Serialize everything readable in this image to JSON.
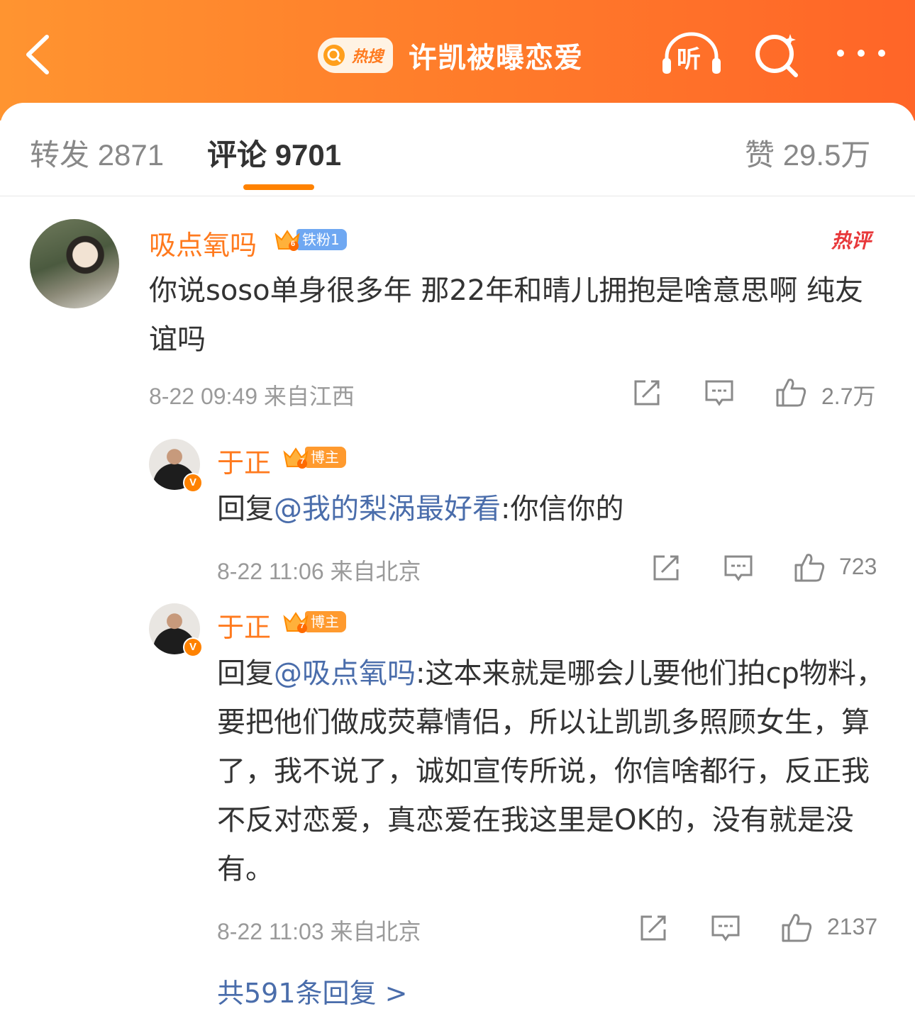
{
  "header": {
    "hot_badge": "热搜",
    "topic": "许凯被曝恋爱",
    "listen_label": "听",
    "colors": {
      "gradient_start": "#ff9430",
      "gradient_end": "#ff6528"
    }
  },
  "tabs": [
    {
      "label": "转发",
      "count": "2871"
    },
    {
      "label": "评论",
      "count": "9701",
      "active": true
    },
    {
      "label": "赞",
      "count": "29.5万"
    }
  ],
  "comments": [
    {
      "user": "吸点氧吗",
      "badge_level": "6",
      "badge": "铁粉1",
      "tag": "热评",
      "text": "你说soso单身很多年 那22年和晴儿拥抱是啥意思啊 纯友谊吗",
      "time": "8-22 09:49",
      "location": "来自江西",
      "likes": "2.7万"
    },
    {
      "user": "于正",
      "badge_level": "7",
      "badge": "博主",
      "verified": "V",
      "reply_prefix": "回复",
      "mention": "@我的梨涡最好看",
      "text": ":你信你的",
      "time": "8-22 11:06",
      "location": "来自北京",
      "likes": "723"
    },
    {
      "user": "于正",
      "badge_level": "7",
      "badge": "博主",
      "verified": "V",
      "reply_prefix": "回复",
      "mention": "@吸点氧吗",
      "text": ":这本来就是哪会儿要他们拍cp物料，要把他们做成荧幕情侣，所以让凯凯多照顾女生，算了，我不说了，诚如宣传所说，你信啥都行，反正我不反对恋爱，真恋爱在我这里是OK的，没有就是没有。",
      "time": "8-22 11:03",
      "location": "来自北京",
      "likes": "2137"
    }
  ],
  "more_replies": "共591条回复 >",
  "colors": {
    "accent": "#ff8200",
    "username": "#ff7a1e",
    "link": "#4a6dab",
    "hot_tag": "#e8383a"
  }
}
